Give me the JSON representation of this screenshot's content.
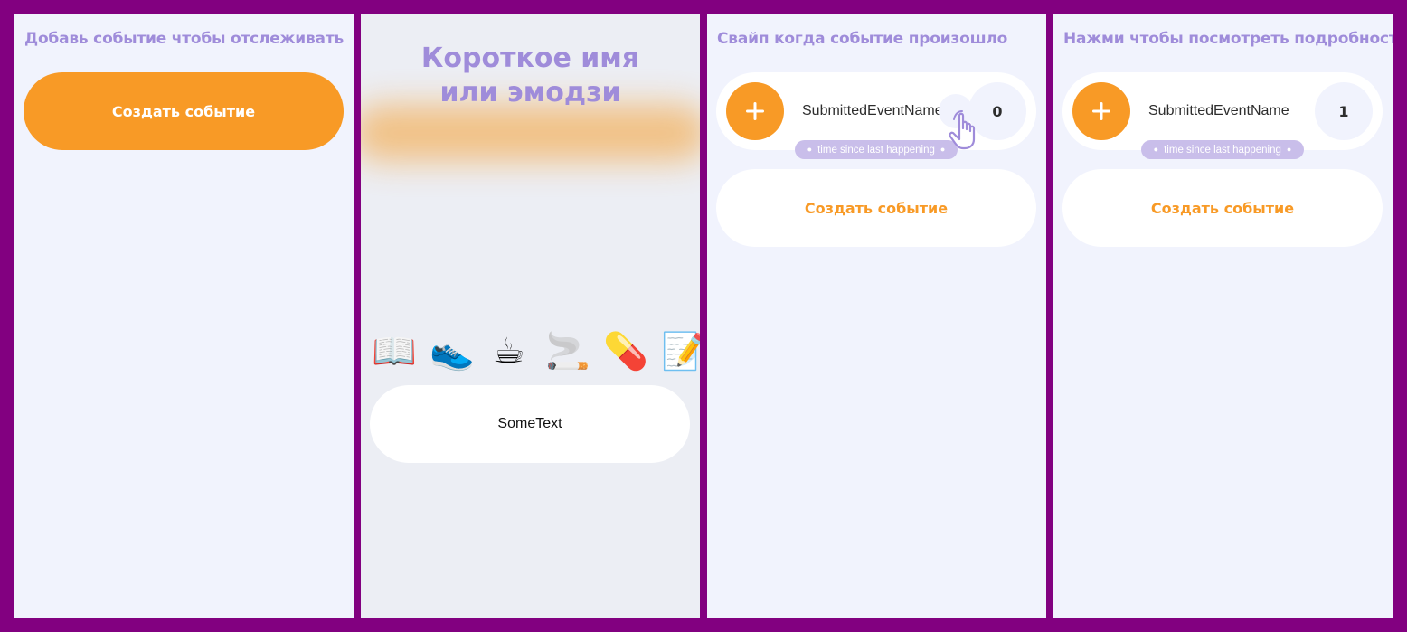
{
  "panels": [
    {
      "hint": "Добавь событие чтобы отслеживать",
      "create_button": "Создать событие"
    },
    {
      "title_line1": "Короткое имя",
      "title_line2": "или эмодзи",
      "emojis": [
        "📖",
        "👟",
        "☕",
        "🚬",
        "💊",
        "📝"
      ],
      "name_field_value": "SomeText"
    },
    {
      "hint": "Свайп когда событие произошло",
      "event": {
        "icon": "plus-icon",
        "name": "SubmittedEventName",
        "count": "0",
        "since_label": "time since last happening"
      },
      "gesture_icon": "swipe-hand-icon",
      "create_button": "Создать событие"
    },
    {
      "hint": "Нажми чтобы посмотреть подробности",
      "event": {
        "icon": "plus-icon",
        "name": "SubmittedEventName",
        "count": "1",
        "since_label": "time since last happening"
      },
      "create_button": "Создать событие"
    }
  ],
  "colors": {
    "frame": "#820080",
    "background": "#F1F3FD",
    "accent_orange": "#F89A26",
    "hint_purple": "#9F8CDA",
    "badge_purple": "#C9BEEA"
  }
}
